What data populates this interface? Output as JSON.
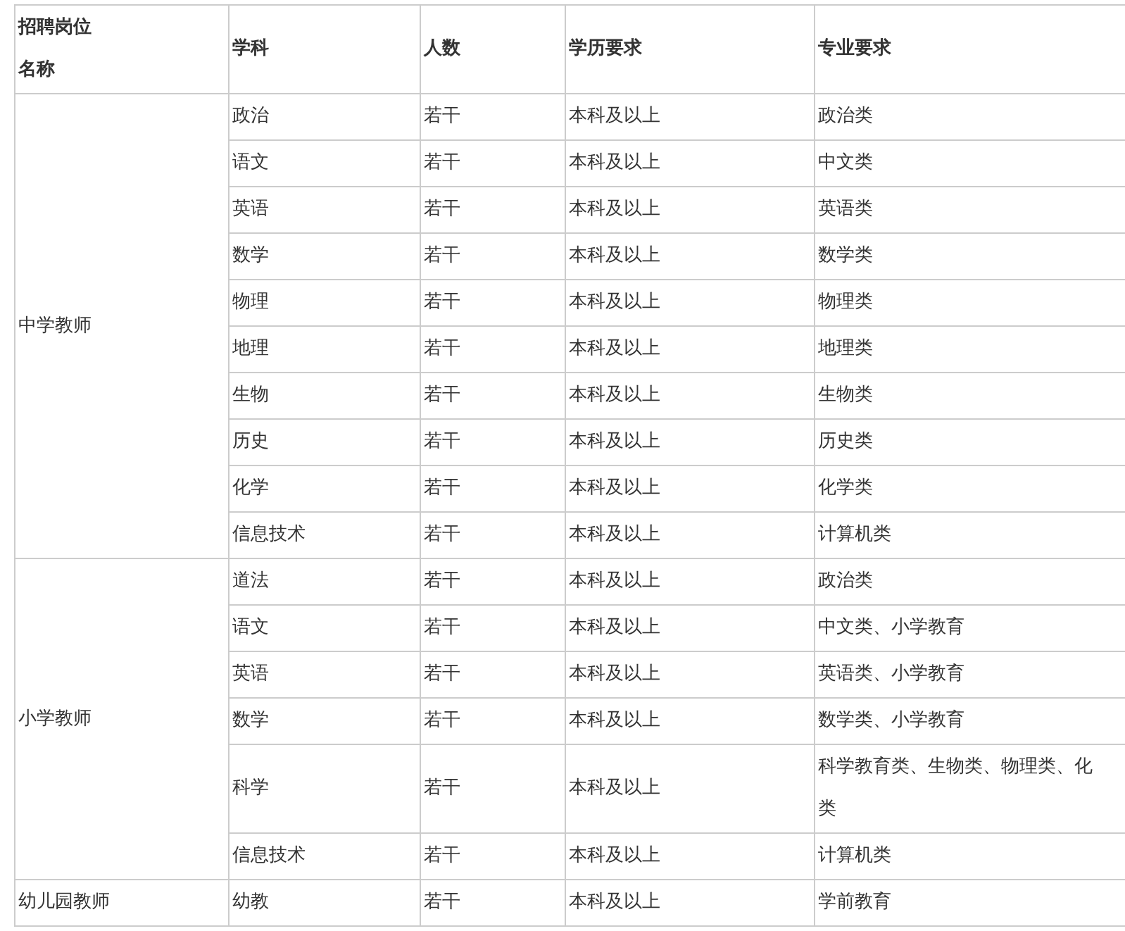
{
  "table": {
    "columns": [
      [
        "招聘岗位",
        "名称"
      ],
      [
        "学科"
      ],
      [
        "人数"
      ],
      [
        "学历要求"
      ],
      [
        "专业要求"
      ]
    ],
    "groups": [
      {
        "position": "中学教师",
        "rows": [
          {
            "subject": "政治",
            "count": "若干",
            "education": "本科及以上",
            "major": [
              "政治类"
            ]
          },
          {
            "subject": "语文",
            "count": "若干",
            "education": "本科及以上",
            "major": [
              "中文类"
            ]
          },
          {
            "subject": "英语",
            "count": "若干",
            "education": "本科及以上",
            "major": [
              "英语类"
            ]
          },
          {
            "subject": "数学",
            "count": "若干",
            "education": "本科及以上",
            "major": [
              "数学类"
            ]
          },
          {
            "subject": "物理",
            "count": "若干",
            "education": "本科及以上",
            "major": [
              "物理类"
            ]
          },
          {
            "subject": "地理",
            "count": "若干",
            "education": "本科及以上",
            "major": [
              "地理类"
            ]
          },
          {
            "subject": "生物",
            "count": "若干",
            "education": "本科及以上",
            "major": [
              "生物类"
            ]
          },
          {
            "subject": "历史",
            "count": "若干",
            "education": "本科及以上",
            "major": [
              "历史类"
            ]
          },
          {
            "subject": "化学",
            "count": "若干",
            "education": "本科及以上",
            "major": [
              "化学类"
            ]
          },
          {
            "subject": "信息技术",
            "count": "若干",
            "education": "本科及以上",
            "major": [
              "计算机类"
            ]
          }
        ]
      },
      {
        "position": "小学教师",
        "rows": [
          {
            "subject": "道法",
            "count": "若干",
            "education": "本科及以上",
            "major": [
              "政治类"
            ]
          },
          {
            "subject": "语文",
            "count": "若干",
            "education": "本科及以上",
            "major": [
              "中文类、小学教育"
            ]
          },
          {
            "subject": "英语",
            "count": "若干",
            "education": "本科及以上",
            "major": [
              "英语类、小学教育"
            ]
          },
          {
            "subject": "数学",
            "count": "若干",
            "education": "本科及以上",
            "major": [
              "数学类、小学教育"
            ]
          },
          {
            "subject": "科学",
            "count": "若干",
            "education": "本科及以上",
            "major": [
              "科学教育类、生物类、物理类、化",
              "类"
            ]
          },
          {
            "subject": "信息技术",
            "count": "若干",
            "education": "本科及以上",
            "major": [
              "计算机类"
            ]
          }
        ]
      },
      {
        "position": "幼儿园教师",
        "rows": [
          {
            "subject": "幼教",
            "count": "若干",
            "education": "本科及以上",
            "major": [
              "学前教育"
            ]
          }
        ]
      }
    ]
  }
}
